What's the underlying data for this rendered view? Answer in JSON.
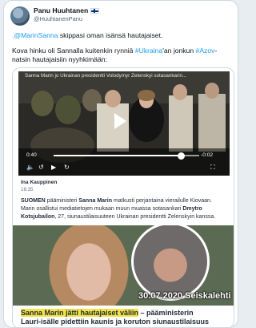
{
  "tweet": {
    "author_name": "Panu Huuhtanen",
    "author_handle": "@HuuhtanenPanu",
    "line1_mention": ".@MarinSanna",
    "line1_rest": " skippasi oman isänsä hautajaiset.",
    "line2_start": "Kova hinku oli Sannalla kuitenkin rynniä ",
    "line2_tag1": "#Ukraina",
    "line2_mid": "'an jonkun ",
    "line2_tag2": "#Azov",
    "line2_end": "-",
    "line3": "natsin hautajaisiin nyyhkimään:"
  },
  "video": {
    "title_overlay": "Sanna Marin jo Ukrainan presidentti Volodymyr Zelenskyi sotasankarin...",
    "time_elapsed": "0:40",
    "time_remaining": "-0:02",
    "controls": [
      "speaker-icon",
      "rewind-10-icon",
      "play-icon",
      "forward-10-icon",
      "fullscreen-icon"
    ]
  },
  "article": {
    "author": "Ina Kauppinen",
    "time": "16:35",
    "p1_bold": "SUOMEN",
    "p1_a": " pääministeri ",
    "p1_name": "Sanna Marin",
    "p1_b": " matkusti perjantaina vierailulle Kiovaan.",
    "p2": "Marin osallistui mediatietojen mukaan muun muassa sotasankari ",
    "p2_name": "Dmytro",
    "p3_name": "Kotsjubailon",
    "p3": ", 27, siunaustilaisuuteen Ukrainan presidentti Zelenskyin kanssa."
  },
  "image_caption": "30.07.2020 Seiskalehti",
  "headline": {
    "highlight": "Sanna Marin jätti hautajaiset väliin",
    "rest": " – pääministerin",
    "line2": "Lauri-isälle pidettiin kaunis ja koruton siunaustilaisuus"
  },
  "colors": {
    "link": "#1d9bf0",
    "highlight": "#f2e34a",
    "border": "#cfd9de"
  }
}
